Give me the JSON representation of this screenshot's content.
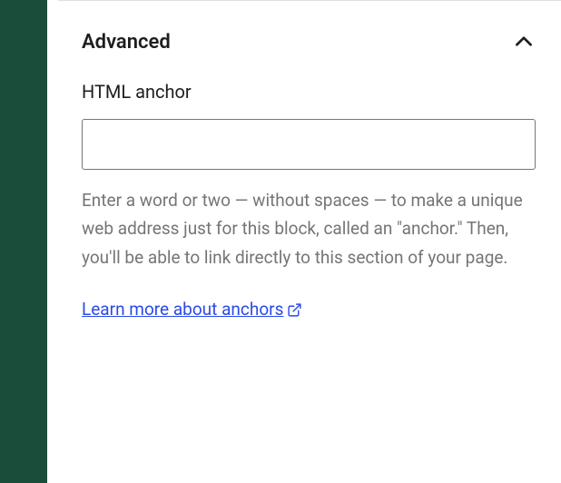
{
  "panel": {
    "title": "Advanced",
    "fields": {
      "htmlAnchor": {
        "label": "HTML anchor",
        "value": "",
        "help": "Enter a word or two — without spaces — to make a unique web address just for this block, called an \"anchor.\" Then, you'll be able to link directly to this section of your page.",
        "linkText": "Learn more about anchors"
      }
    }
  },
  "colors": {
    "accent": "#1a4d3a",
    "link": "#2b4ae6",
    "muted": "#757575"
  }
}
